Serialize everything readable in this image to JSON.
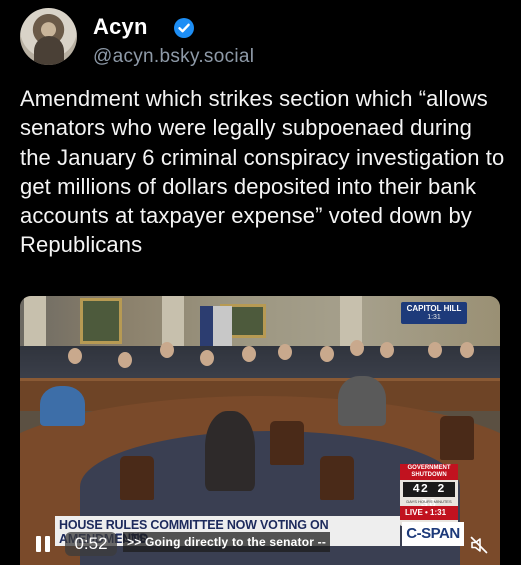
{
  "post": {
    "author": {
      "display_name": "Acyn",
      "handle": "@acyn.bsky.social",
      "verified": true
    },
    "text": "Amendment which strikes section which “allows senators who were legally subpoenaed during the January 6 criminal conspiracy investigation to get millions of dollars deposited into their bank accounts at taxpayer expense” voted down by Republicans"
  },
  "video": {
    "overlay": {
      "network_badge_line1": "CAPITOL HILL",
      "network_badge_line2": "1:31",
      "shutdown_header": "GOVERNMENT SHUTDOWN",
      "shutdown_counter": "42 2 30",
      "shutdown_units": "DAYS HOURS MINUTES",
      "live_label": "LIVE • 1:31",
      "lower_third_title": "HOUSE RULES COMMITTEE NOW VOTING ON AMENDMENTS",
      "lower_third_sub": "FUND",
      "logo": "C-SPAN"
    },
    "controls": {
      "time": "0:52",
      "caption": ">> Going directly to the senator --",
      "play_state": "pause-icon",
      "mute_state": "muted-icon"
    }
  },
  "colors": {
    "background": "#000000",
    "verified_badge": "#1d8ef5",
    "handle": "#8e9aa8",
    "cspan_blue": "#1d3a7a",
    "alert_red": "#c1121f"
  }
}
